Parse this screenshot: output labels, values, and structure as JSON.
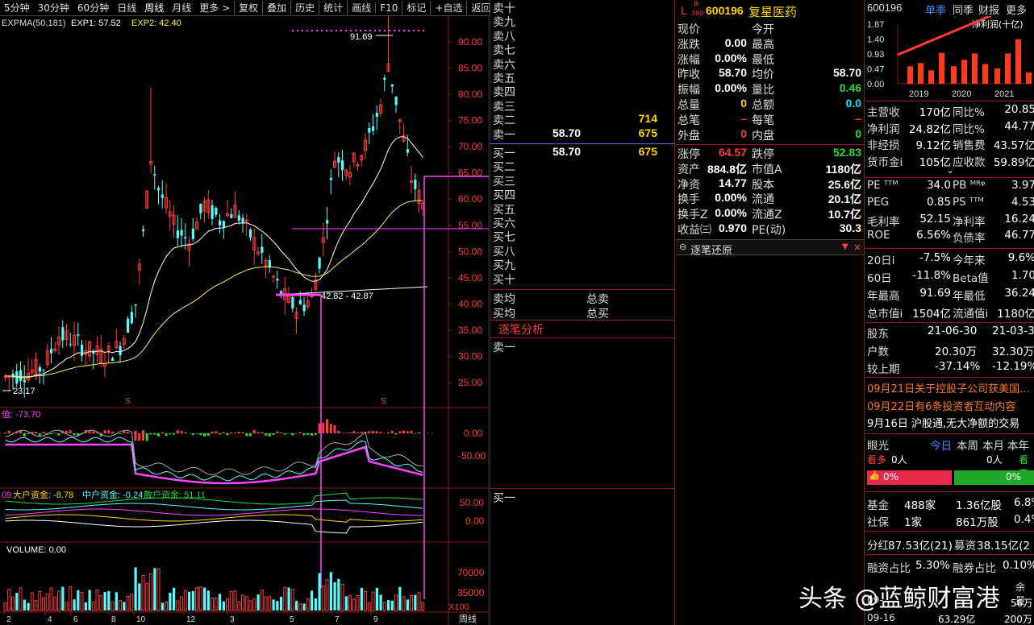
{
  "toolbar": {
    "periods": [
      "5分钟",
      "30分钟",
      "60分钟",
      "日线",
      "周线",
      "月线",
      "更多 >"
    ],
    "active_period": "周线",
    "buttons": [
      "复权",
      "叠加",
      "历史",
      "统计",
      "画线",
      "F10",
      "标记",
      "+自选",
      "返回"
    ]
  },
  "chart": {
    "expma_legend": "EXPMA(50,181)",
    "exp1_label": "EXP1: 57.52",
    "exp2_label": "EXP2: 42.40",
    "high_marker": "91.69",
    "low_marker": "23.17",
    "box_label": "42.82 - 42.87",
    "price_ticks": [
      "90.00",
      "85.00",
      "80.00",
      "75.00",
      "70.00",
      "65.00",
      "60.00",
      "55.00",
      "50.00",
      "45.00",
      "40.00",
      "35.00",
      "30.00",
      "25.00"
    ],
    "ind1_legend": "值: -73.70",
    "ind1_ticks": [
      "0.00",
      "-50.00"
    ],
    "ind2_legend": {
      "prefix": "09",
      "big": "大户资金: -8.78",
      "mid": "中户资金: -0.24",
      "small": "散户资金: 51.11"
    },
    "ind2_ticks": [
      "50.00",
      "0.00"
    ],
    "volume_legend": "VOLUME: 0.00",
    "vol_ticks": [
      "70000",
      "35000"
    ],
    "vol_unit": "X100",
    "period_footer": "周线",
    "x_ticks": [
      "2",
      "4",
      "6",
      "8",
      "10",
      "12",
      "3",
      "5",
      "7",
      "9"
    ],
    "s_marks": [
      "S",
      "S"
    ]
  },
  "book": {
    "sell_labels": [
      "卖十",
      "卖九",
      "卖八",
      "卖七",
      "卖六",
      "卖五",
      "卖四",
      "卖三",
      "卖二",
      "卖一"
    ],
    "sell2_vol": "714",
    "sell1_price": "58.70",
    "sell1_vol": "675",
    "buy_labels": [
      "买一",
      "买二",
      "买三",
      "买四",
      "买五",
      "买六",
      "买七",
      "买八",
      "买九",
      "买十"
    ],
    "buy1_price": "58.70",
    "buy1_vol": "675",
    "avg_sell": "卖均",
    "total_sell": "总卖",
    "avg_buy": "买均",
    "total_buy": "总买",
    "tick_title": "逐笔分析",
    "tick_sell": "卖一",
    "tick_buy": "买一"
  },
  "quote": {
    "flag_l": "L",
    "flag_r": "R",
    "flag_300": "300",
    "code": "600196",
    "name": "复星医药",
    "rows": [
      {
        "l": "现价",
        "lv": "",
        "r": "今开",
        "rv": ""
      },
      {
        "l": "涨跌",
        "lv": "0.00",
        "r": "最高",
        "rv": ""
      },
      {
        "l": "涨幅",
        "lv": "0.00%",
        "r": "最低",
        "rv": ""
      },
      {
        "l": "昨收",
        "lv": "58.70",
        "r": "均价",
        "rv": "58.70"
      },
      {
        "l": "振幅",
        "lv": "0.00%",
        "r": "量比",
        "rv": "0.46"
      },
      {
        "l": "总量",
        "lv": "0",
        "r": "总额",
        "rv": "0.0"
      },
      {
        "l": "总笔",
        "lv": "–",
        "r": "每笔",
        "rv": "–"
      },
      {
        "l": "外盘",
        "lv": "0",
        "r": "内盘",
        "rv": "0"
      }
    ],
    "rows2": [
      {
        "l": "涨停",
        "lv": "64.57",
        "r": "跌停",
        "rv": "52.83"
      },
      {
        "l": "资产",
        "lv": "884.8亿",
        "r": "市值A",
        "rv": "1180亿"
      },
      {
        "l": "净资",
        "lv": "14.77",
        "r": "股本",
        "rv": "25.6亿"
      },
      {
        "l": "换手",
        "lv": "0.00%",
        "r": "流通",
        "rv": "20.1亿"
      },
      {
        "l": "换手Z",
        "lv": "0.00%",
        "r": "流通Z",
        "rv": "10.7亿"
      },
      {
        "l": "收益㈢",
        "lv": "0.970",
        "r": "PE(动)",
        "rv": "30.3"
      }
    ],
    "tick_restore": "逐笔还原"
  },
  "right": {
    "code": "600196",
    "tabs": [
      "单季",
      "同季",
      "财报",
      "更多"
    ],
    "chart_title": "净利润(十亿)",
    "chart_data": {
      "type": "bar",
      "title": "净利润(十亿)",
      "years": [
        "2019",
        "2020",
        "2021"
      ],
      "yticks": [
        "1.87",
        "1.40",
        "0.93",
        "0.47",
        "0.00"
      ],
      "ylim": [
        0,
        1.87
      ],
      "values": [
        0.55,
        0.65,
        0.42,
        0.97,
        0.55,
        0.75,
        0.95,
        0.62,
        0.48,
        0.95,
        1.4,
        0.35
      ]
    },
    "fin": [
      {
        "l": "主营收",
        "lv": "170亿",
        "r": "同比%",
        "rv": "20.85"
      },
      {
        "l": "净利润",
        "lv": "24.82亿",
        "r": "同比%",
        "rv": "44.77"
      },
      {
        "l": "非经损",
        "lv": "9.12亿",
        "r": "销售费",
        "rv": "43.57亿"
      },
      {
        "l": "货币金ⅰ",
        "lv": "105亿",
        "r": "应收款",
        "rv": "59.89亿"
      }
    ],
    "val": [
      {
        "l": "PE ᵀᵀᴹ",
        "lv": "34.0",
        "r": "PB ᴹᴿᵠ",
        "rv": "3.97"
      },
      {
        "l": "PEG",
        "lv": "0.85",
        "r": "PS ᵀᵀᴹ",
        "rv": "4.53"
      },
      {
        "l": "毛利率",
        "lv": "52.15",
        "r": "净利率",
        "rv": "16.24"
      },
      {
        "l": "ROE",
        "lv": "6.56%",
        "r": "负债率",
        "rv": "46.77"
      }
    ],
    "perf": [
      {
        "l": "20日ⅰ",
        "lv": "-7.5%",
        "r": "今年来",
        "rv": "9.6%"
      },
      {
        "l": "60日",
        "lv": "-11.8%",
        "r": "Beta值",
        "rv": "1.70"
      },
      {
        "l": "年最高",
        "lv": "91.69",
        "r": "年最低",
        "rv": "36.24"
      },
      {
        "l": "总市值ⅰ",
        "lv": "1504亿",
        "r": "流通值ⅰ",
        "rv": "1180亿"
      }
    ],
    "holders_head": {
      "l": "股东",
      "d1": "21-06-30",
      "d2": "21-03-31"
    },
    "holders": [
      {
        "l": "户数",
        "v1": "20.30万",
        "v2": "32.30万"
      },
      {
        "l": "较上期",
        "v1": "-37.14%",
        "v2": "-12.19%"
      }
    ],
    "news": [
      "09月21日关于控股子公司获美国...",
      "09月22日有6条投资者互动内容",
      "9月16日 沪股通,无大净额的交易"
    ],
    "eye_tabs": [
      "眼光",
      "今日",
      "本周",
      "本月",
      "本年"
    ],
    "bull_label": "看多",
    "bull_count": "0人",
    "bear_count": "0人",
    "bear_label": "看空",
    "bull_pct": "0%",
    "bear_pct": "0%",
    "funds": [
      {
        "l": "基金",
        "v1": "488家",
        "v2": "1.36亿股",
        "v3": "6.8%"
      },
      {
        "l": "社保",
        "v1": "1家",
        "v2": "861万股",
        "v3": "0.4%"
      }
    ],
    "div": {
      "l": "分红",
      "v": "87.53亿(21)",
      "r": "募资",
      "rv": "38.15亿(2"
    },
    "margin": {
      "l": "融资占比",
      "v": "5.30%",
      "r": "融券占比",
      "rv": "0.10%"
    },
    "bottom_left": [
      "09-",
      "09-16"
    ],
    "bottom_right": [
      "余量",
      "56万",
      "200万"
    ],
    "bottom_mid": [
      "63.29亿"
    ]
  },
  "watermark": "头条 @蓝鲸财富港"
}
